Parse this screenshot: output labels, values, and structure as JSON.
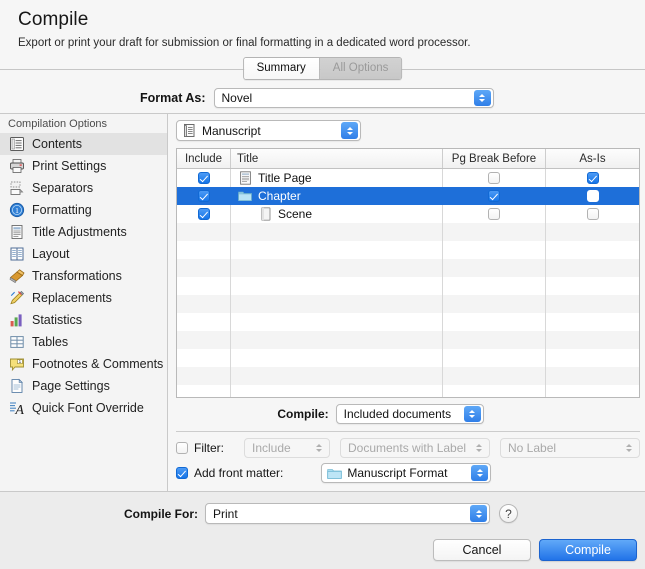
{
  "header": {
    "title": "Compile",
    "subtitle": "Export or print your draft for submission or final formatting in a dedicated word processor."
  },
  "tabs": [
    {
      "label": "Summary",
      "active": true
    },
    {
      "label": "All Options",
      "active": false
    }
  ],
  "format_as": {
    "label": "Format As:",
    "value": "Novel"
  },
  "sidebar": {
    "header": "Compilation Options",
    "items": [
      {
        "label": "Contents",
        "icon": "contents-icon",
        "selected": true
      },
      {
        "label": "Print Settings",
        "icon": "printer-icon",
        "selected": false
      },
      {
        "label": "Separators",
        "icon": "separators-icon",
        "selected": false
      },
      {
        "label": "Formatting",
        "icon": "formatting-icon",
        "selected": false
      },
      {
        "label": "Title Adjustments",
        "icon": "document-icon",
        "selected": false
      },
      {
        "label": "Layout",
        "icon": "layout-icon",
        "selected": false
      },
      {
        "label": "Transformations",
        "icon": "transformations-icon",
        "selected": false
      },
      {
        "label": "Replacements",
        "icon": "replacements-icon",
        "selected": false
      },
      {
        "label": "Statistics",
        "icon": "statistics-icon",
        "selected": false
      },
      {
        "label": "Tables",
        "icon": "tables-icon",
        "selected": false
      },
      {
        "label": "Footnotes & Comments",
        "icon": "footnotes-icon",
        "selected": false
      },
      {
        "label": "Page Settings",
        "icon": "page-settings-icon",
        "selected": false
      },
      {
        "label": "Quick Font Override",
        "icon": "font-override-icon",
        "selected": false
      }
    ]
  },
  "source_popup": {
    "value": "Manuscript",
    "icon": "manuscript-icon"
  },
  "table": {
    "columns": [
      "Include",
      "Title",
      "Pg Break Before",
      "As-Is"
    ],
    "rows": [
      {
        "include": true,
        "title": "Title Page",
        "icon": "text-document-icon",
        "indent": false,
        "pg_break_before": false,
        "as_is": true,
        "selected": false
      },
      {
        "include": true,
        "title": "Chapter",
        "icon": "folder-icon",
        "indent": false,
        "pg_break_before": true,
        "as_is": false,
        "selected": true
      },
      {
        "include": true,
        "title": "Scene",
        "icon": "blank-document-icon",
        "indent": true,
        "pg_break_before": false,
        "as_is": false,
        "selected": false
      }
    ],
    "empty_row_count": 11
  },
  "compile_scope": {
    "label": "Compile:",
    "value": "Included documents"
  },
  "filter": {
    "label": "Filter:",
    "checked": false,
    "mode": "Include",
    "type": "Documents with Label",
    "label_value": "No Label"
  },
  "front_matter": {
    "label": "Add front matter:",
    "checked": true,
    "value": "Manuscript Format",
    "icon": "folder-icon"
  },
  "footer": {
    "compile_for_label": "Compile For:",
    "compile_for_value": "Print",
    "help_label": "?",
    "cancel_label": "Cancel",
    "compile_label": "Compile"
  },
  "colors": {
    "accent": "#1e6fd9",
    "primary_button": "#2173e8",
    "selection": "#1e6fd9",
    "window_bg": "#ececec"
  }
}
